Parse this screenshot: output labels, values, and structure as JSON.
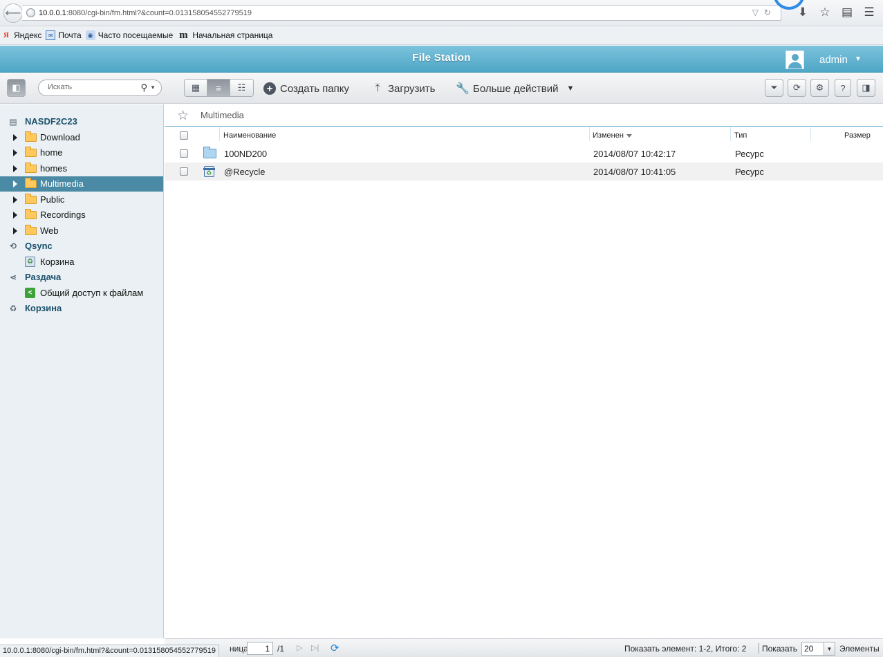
{
  "browser": {
    "url_host": "10.0.0.1",
    "url_rest": ":8080/cgi-bin/fm.html?&count=0.013158054552779519",
    "status_url": "10.0.0.1:8080/cgi-bin/fm.html?&count=0.013158054552779519"
  },
  "bookmarks": [
    {
      "label": "Яндекс",
      "icon": "yandex-icon"
    },
    {
      "label": "Почта",
      "icon": "mail-icon"
    },
    {
      "label": "Часто посещаемые",
      "icon": "frequently-visited-icon"
    },
    {
      "label": "Начальная страница",
      "icon": "start-page-icon"
    }
  ],
  "app": {
    "title": "File Station",
    "user": "admin"
  },
  "toolbar": {
    "search_placeholder": "Искать",
    "create_folder": "Создать папку",
    "upload": "Загрузить",
    "more_actions": "Больше действий"
  },
  "sidebar": {
    "root": "NASDF2C23",
    "folders": [
      "Download",
      "home",
      "homes",
      "Multimedia",
      "Public",
      "Recordings",
      "Web"
    ],
    "selected": "Multimedia",
    "qsync": "Qsync",
    "qsync_trash": "Корзина",
    "share": "Раздача",
    "share_item": "Общий доступ к файлам",
    "trash": "Корзина"
  },
  "breadcrumb": "Multimedia",
  "columns": {
    "name": "Наименование",
    "modified": "Изменен",
    "type": "Тип",
    "size": "Размер"
  },
  "rows": [
    {
      "name": "100ND200",
      "modified": "2014/08/07 10:42:17",
      "type": "Ресурс",
      "icon": "folder-icon"
    },
    {
      "name": "@Recycle",
      "modified": "2014/08/07 10:41:05",
      "type": "Ресурс",
      "icon": "recycle-bin-icon"
    }
  ],
  "footer": {
    "page_label": "ница",
    "page_value": "1",
    "page_total": "/1",
    "show_items": "Показать элемент: 1-2, Итого: 2",
    "show_label": "Показать",
    "per_page": "20",
    "items_label": "Элементы"
  },
  "colors": {
    "header_blue": "#4ea6c6",
    "selected_row": "#4a8aa4",
    "sidebar_bg": "#eaf0f3"
  }
}
